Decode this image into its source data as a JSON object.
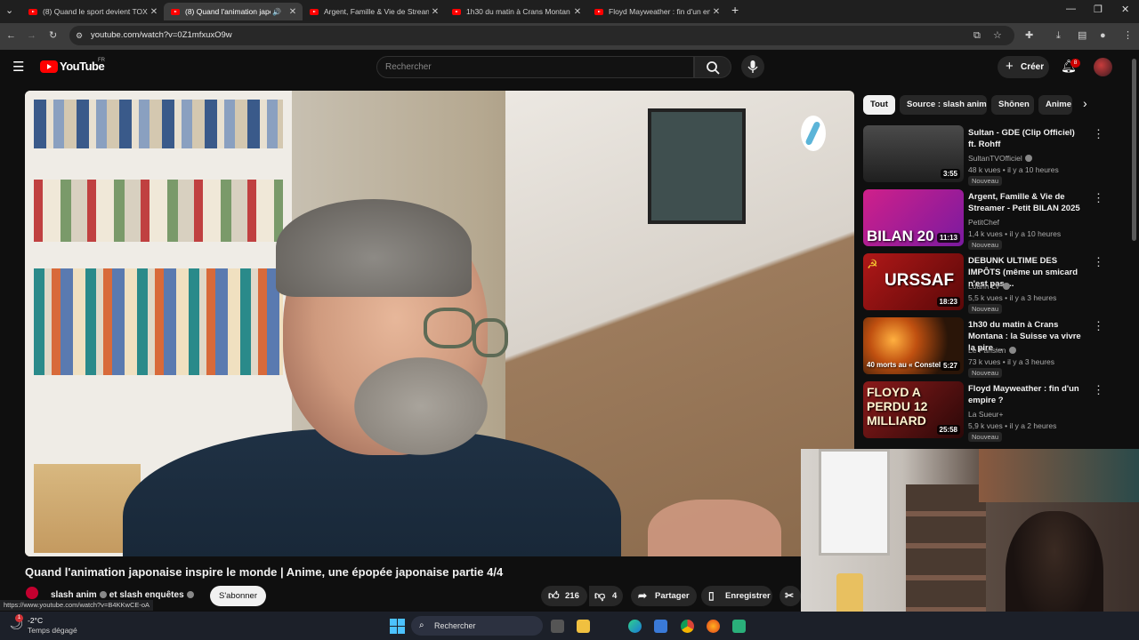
{
  "browser": {
    "tabs": [
      {
        "title": "(8) Quand le sport devient TOXI",
        "active": false
      },
      {
        "title": "(8) Quand l'animation japo",
        "active": true
      },
      {
        "title": "Argent, Famille & Vie de Strean",
        "active": false
      },
      {
        "title": "1h30 du matin à Crans Montan",
        "active": false
      },
      {
        "title": "Floyd Mayweather : fin d'un em",
        "active": false
      }
    ],
    "url": "youtube.com/watch?v=0Z1mfxuxO9w"
  },
  "youtube": {
    "logo_text": "YouTube",
    "country": "FR",
    "search_placeholder": "Rechercher",
    "create_label": "Créer",
    "notification_count": "8"
  },
  "video": {
    "title": "Quand l'animation japonaise inspire le monde | Anime, une épopée japonaise partie 4/4",
    "channel": "slash anim",
    "channel_connector": "et slash enquêtes",
    "subscribe_label": "S'abonner",
    "likes": "216",
    "dislikes": "4",
    "share_label": "Partager",
    "save_label": "Enregistrer"
  },
  "chips": [
    "Tout",
    "Source : slash anim",
    "Shōnen",
    "Anime"
  ],
  "recommendations": [
    {
      "title": "Sultan - GDE (Clip Officiel) ft. Rohff",
      "channel": "SultanTVOfficiel",
      "verified": true,
      "meta": "48 k vues • il y a 10 heures",
      "badge": "Nouveau",
      "duration": "3:55",
      "thumb_text": "",
      "thumb_color": "#3a3a3a"
    },
    {
      "title": "Argent, Famille & Vie de Streamer - Petit BILAN 2025",
      "channel": "PetitChef",
      "verified": false,
      "meta": "1,4 k vues • il y a 10 heures",
      "badge": "Nouveau",
      "duration": "11:13",
      "thumb_text": "BILAN 20",
      "thumb_color": "#b0207a"
    },
    {
      "title": "DEBUNK ULTIME DES IMPÔTS (même un smicard n'est pas ...",
      "channel": "Loann LV",
      "verified": true,
      "meta": "5,5 k vues • il y a 3 heures",
      "badge": "Nouveau",
      "duration": "18:23",
      "thumb_text": "URSSAF",
      "thumb_color": "#8a1010"
    },
    {
      "title": "1h30 du matin à Crans Montana : la Suisse va vivre la pire ...",
      "channel": "Le Parisien",
      "verified": true,
      "meta": "73 k vues • il y a 3 heures",
      "badge": "Nouveau",
      "duration": "5:27",
      "thumb_text": "40 morts au « Constel",
      "thumb_color": "#4a2a10"
    },
    {
      "title": "Floyd Mayweather : fin d'un empire ?",
      "channel": "La Sueur+",
      "verified": false,
      "meta": "5,9 k vues • il y a 2 heures",
      "badge": "Nouveau",
      "duration": "25:58",
      "thumb_text": "FLOYD A PERDU 12 MILLIARD",
      "thumb_color": "#7a1515"
    }
  ],
  "status_url": "https://www.youtube.com/watch?v=B4KKwCE-oA",
  "taskbar": {
    "temperature": "-2°C",
    "condition": "Temps dégagé",
    "search_label": "Rechercher"
  }
}
